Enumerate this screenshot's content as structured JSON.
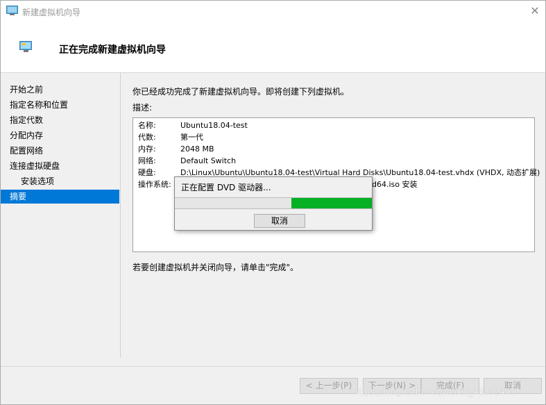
{
  "window": {
    "title": "新建虚拟机向导",
    "close_glyph": "✕"
  },
  "header": {
    "title": "正在完成新建虚拟机向导"
  },
  "sidebar": {
    "items": [
      {
        "label": "开始之前"
      },
      {
        "label": "指定名称和位置"
      },
      {
        "label": "指定代数"
      },
      {
        "label": "分配内存"
      },
      {
        "label": "配置网络"
      },
      {
        "label": "连接虚拟硬盘"
      },
      {
        "label": "安装选项"
      },
      {
        "label": "摘要"
      }
    ],
    "active_index": 7
  },
  "main": {
    "intro": "你已经成功完成了新建虚拟机向导。即将创建下列虚拟机。",
    "desc_label": "描述:",
    "summary": [
      {
        "key": "名称:",
        "value": "Ubuntu18.04-test"
      },
      {
        "key": "代数:",
        "value": "第一代"
      },
      {
        "key": "内存:",
        "value": "2048 MB"
      },
      {
        "key": "网络:",
        "value": "Default Switch"
      },
      {
        "key": "硬盘:",
        "value": "D:\\Linux\\Ubuntu\\Ubuntu18.04-test\\Virtual Hard Disks\\Ubuntu18.04-test.vhdx (VHDX, 动态扩展)"
      },
      {
        "key": "操作系统:",
        "value": "d64.iso 安装"
      }
    ],
    "footer_note": "若要创建虚拟机并关闭向导，请单击\"完成\"。"
  },
  "buttons": {
    "prev": "< 上一步(P)",
    "next": "下一步(N) >",
    "finish": "完成(F)",
    "cancel": "取消"
  },
  "progress_dialog": {
    "message": "正在配置 DVD 驱动器...",
    "cancel_label": "取消",
    "fill_start_fraction": 0.59,
    "fill_end_fraction": 1.0,
    "fill_color": "#06b025"
  },
  "watermark": "https://blog.csdn.net/weixin_43892401",
  "colors": {
    "accent": "#0078d7"
  }
}
